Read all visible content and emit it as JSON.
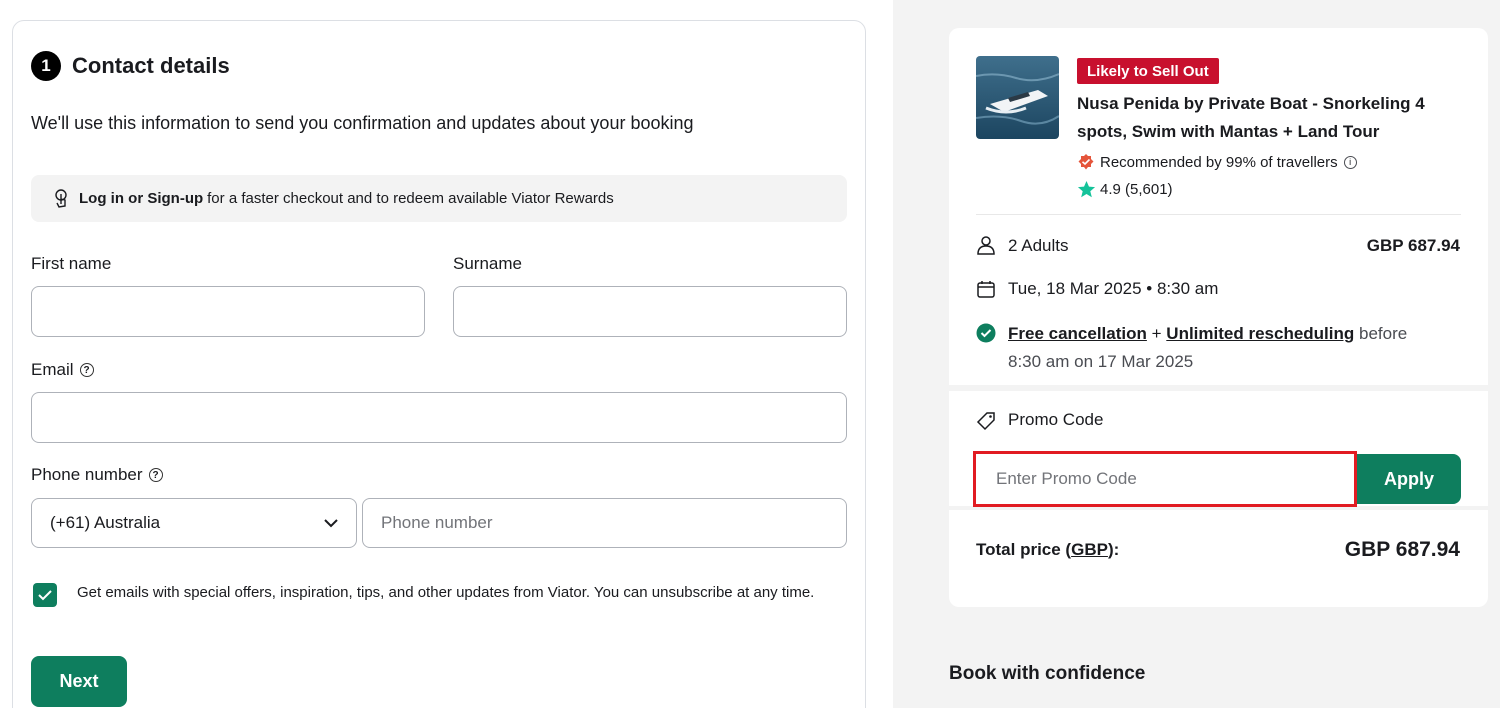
{
  "contact": {
    "step_number": "1",
    "title": "Contact details",
    "intro": "We'll use this information to send you confirmation and updates about your booking",
    "login_bold": "Log in or Sign-up",
    "login_rest": "for a faster checkout and to redeem available Viator Rewards",
    "first_name_label": "First name",
    "surname_label": "Surname",
    "email_label": "Email",
    "phone_label": "Phone number",
    "country_value": "(+61) Australia",
    "phone_placeholder": "Phone number",
    "first_name_value": "",
    "surname_value": "",
    "email_value": "",
    "marketing_checked": true,
    "marketing_text": "Get emails with special offers, inspiration, tips, and other updates from Viator. You can unsubscribe at any time.",
    "next_label": "Next"
  },
  "summary": {
    "badge": "Likely to Sell Out",
    "tour_title": "Nusa Penida by Private Boat - Snorkeling 4 spots, Swim with Mantas + Land Tour",
    "recommended": "Recommended by 99% of travellers",
    "rating": "4.9 (5,601)",
    "travellers": "2 Adults",
    "travellers_price": "GBP 687.94",
    "date": "Tue, 18 Mar 2025 • 8:30 am",
    "free_cancellation": "Free cancellation",
    "plus": "+",
    "unlimited_rescheduling": "Unlimited rescheduling",
    "before": "before",
    "cancel_deadline": "8:30 am on 17 Mar 2025",
    "promo_label": "Promo Code",
    "promo_placeholder": "Enter Promo Code",
    "apply_label": "Apply",
    "total_label": "Total price (",
    "total_currency": "GBP",
    "total_label_end": "):",
    "total_value": "GBP 687.94"
  },
  "confidence_heading": "Book with confidence",
  "colors": {
    "primary_green": "#0e7e5e",
    "badge_red": "#c8102e",
    "highlight_red": "#e11b22",
    "panel_gray": "#f3f3f3"
  }
}
